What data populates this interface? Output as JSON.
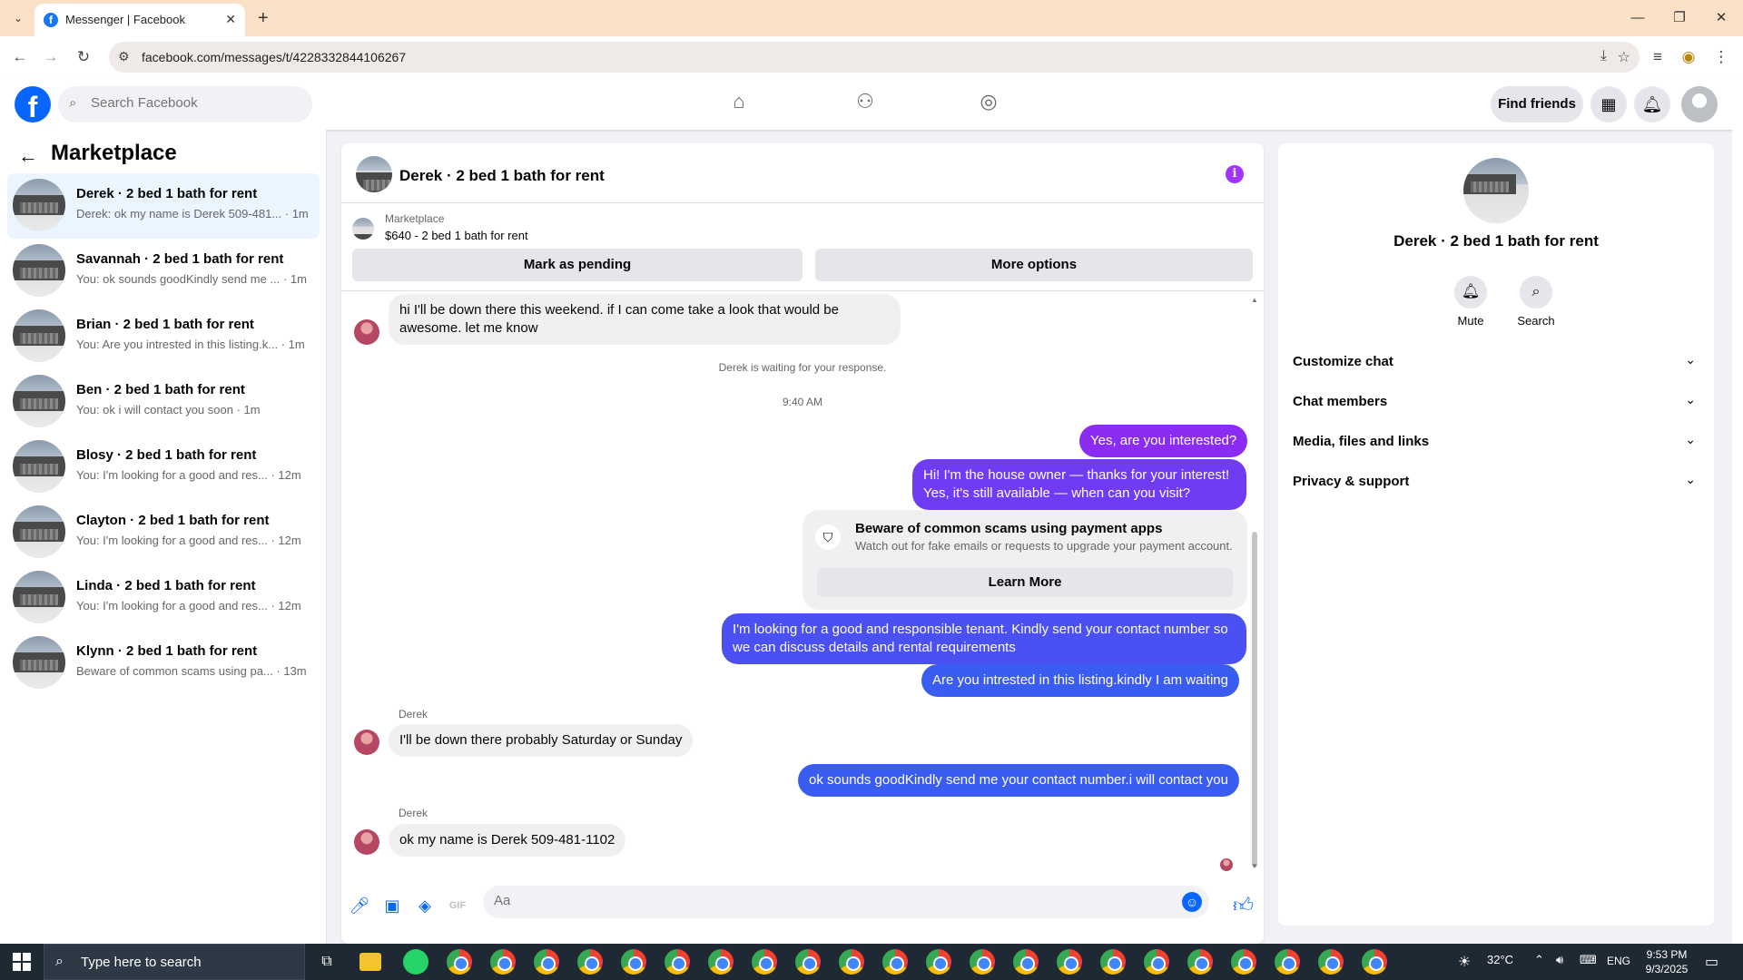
{
  "browser": {
    "tab_title": "Messenger | Facebook",
    "url": "facebook.com/messages/t/4228332844106267"
  },
  "fb": {
    "search_placeholder": "Search Facebook",
    "find_friends": "Find friends"
  },
  "left": {
    "title": "Marketplace",
    "conversations": [
      {
        "name": "Derek · 2 bed 1 bath for rent",
        "snippet": "Derek: ok my name is Derek 509-481... · 1m"
      },
      {
        "name": "Savannah · 2 bed 1 bath for rent",
        "snippet": "You: ok sounds goodKindly send me ... · 1m"
      },
      {
        "name": "Brian · 2 bed 1 bath for rent",
        "snippet": "You: Are you intrested in this listing.k... · 1m"
      },
      {
        "name": "Ben · 2 bed 1 bath for rent",
        "snippet": "You: ok i will contact you soon · 1m"
      },
      {
        "name": "Blosy · 2 bed 1 bath for rent",
        "snippet": "You: I'm looking for a good and res... · 12m"
      },
      {
        "name": "Clayton · 2 bed 1 bath for rent",
        "snippet": "You: I'm looking for a good and res... · 12m"
      },
      {
        "name": "Linda · 2 bed 1 bath for rent",
        "snippet": "You: I'm looking for a good and res... · 12m"
      },
      {
        "name": "Klynn · 2 bed 1 bath for rent",
        "snippet": "Beware of common scams using pa... · 13m"
      }
    ]
  },
  "chat": {
    "title": "Derek · 2 bed 1 bath for rent",
    "listing_label": "Marketplace",
    "listing_price": "$640 - 2 bed 1 bath for rent",
    "mark_pending": "Mark as pending",
    "more_options": "More options",
    "msg1": "hi I'll be down there this weekend. if I can come take a look that would be awesome. let me know",
    "waiting": "Derek is waiting for your response.",
    "time": "9:40 AM",
    "out1": "Yes, are you interested?",
    "out2": "Hi! I'm the house owner — thanks for your interest! Yes, it's still available — when can you visit?",
    "warn_title": "Beware of common scams using payment apps",
    "warn_sub": "Watch out for fake emails or requests to upgrade your payment account.",
    "learn_more": "Learn More",
    "out3": "I'm looking for a good and responsible tenant. Kindly send your contact number so we can discuss details and rental requirements",
    "out4": "Are you intrested in this listing.kindly I am waiting",
    "sender": "Derek",
    "msg2": "I'll be down there probably Saturday or Sunday",
    "out5": "ok sounds goodKindly send me your contact number.i will contact you",
    "msg3": "ok my name is Derek 509-481-1102",
    "composer_placeholder": "Aa"
  },
  "right": {
    "name": "Derek · 2 bed 1 bath for rent",
    "mute": "Mute",
    "search": "Search",
    "rows": [
      "Customize chat",
      "Chat members",
      "Media, files and links",
      "Privacy & support"
    ]
  },
  "taskbar": {
    "search": "Type here to search",
    "temp": "32°C",
    "lang": "ENG",
    "time": "9:53 PM",
    "date": "9/3/2025"
  },
  "colors": {
    "accent": "#0866ff",
    "bubble_purple": "#8b2cf2",
    "bubble_blue": "#3a5cf0"
  }
}
